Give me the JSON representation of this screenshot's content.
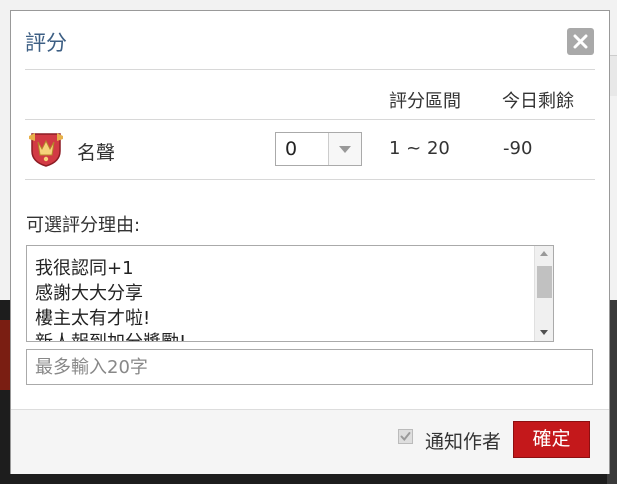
{
  "dialog": {
    "title": "評分",
    "close_icon": "close-icon"
  },
  "columns": {
    "range_header": "評分區間",
    "remaining_header": "今日剩餘"
  },
  "reputation_row": {
    "icon": "medal-icon",
    "label": "名聲",
    "selected_score": "0",
    "range": "1 ~ 20",
    "remaining": "-90"
  },
  "reasons": {
    "label": "可選評分理由:",
    "items": [
      "我很認同+1",
      "感謝大大分享",
      "樓主太有才啦!",
      "新人報到加分獎勵!"
    ]
  },
  "custom_reason": {
    "placeholder": "最多輸入20字",
    "value": ""
  },
  "footer": {
    "notify_checked": true,
    "notify_label": "通知作者",
    "confirm_label": "確定"
  },
  "colors": {
    "title": "#3d5f84",
    "confirm_button": "#c4181b",
    "close_button": "#a9a9a9"
  }
}
